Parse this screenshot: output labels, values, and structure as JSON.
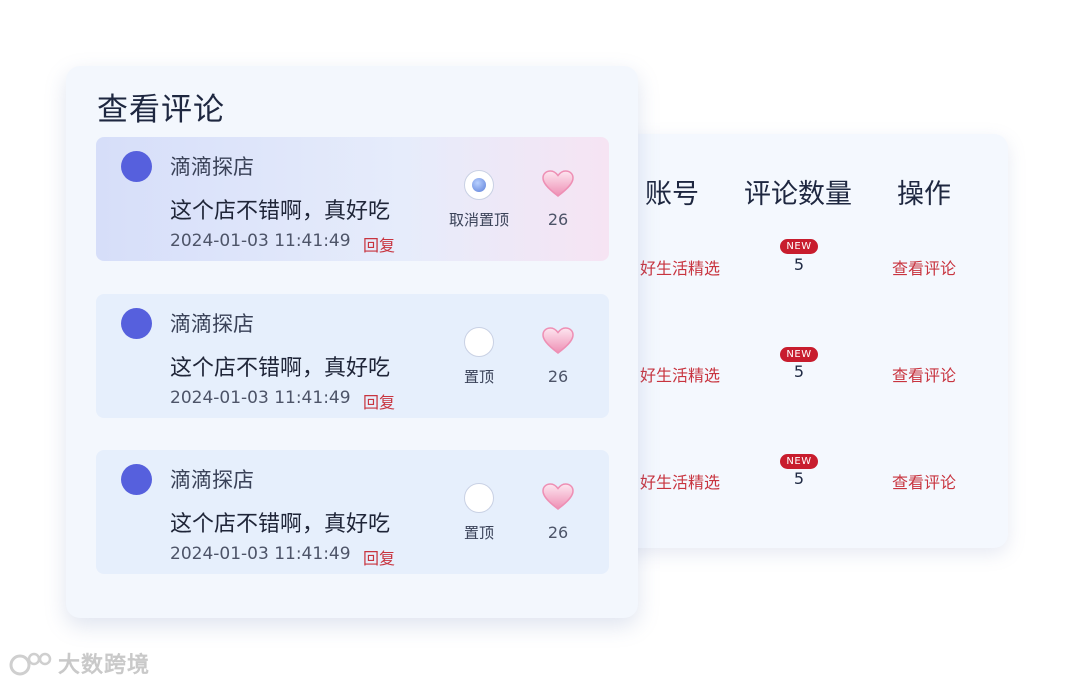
{
  "panel": {
    "title": "查看评论"
  },
  "comments": [
    {
      "username": "滴滴探店",
      "content": "这个店不错啊，真好吃",
      "timestamp": "2024-01-03 11:41:49",
      "reply": "回复",
      "pin_label": "取消置顶",
      "pinned": true,
      "likes": "26"
    },
    {
      "username": "滴滴探店",
      "content": "这个店不错啊，真好吃",
      "timestamp": "2024-01-03 11:41:49",
      "reply": "回复",
      "pin_label": "置顶",
      "pinned": false,
      "likes": "26"
    },
    {
      "username": "滴滴探店",
      "content": "这个店不错啊，真好吃",
      "timestamp": "2024-01-03 11:41:49",
      "reply": "回复",
      "pin_label": "置顶",
      "pinned": false,
      "likes": "26"
    }
  ],
  "table": {
    "headers": {
      "account": "账号",
      "count": "评论数量",
      "ops": "操作"
    },
    "rows": [
      {
        "account": "好生活精选",
        "badge": "NEW",
        "count": "5",
        "action": "查看评论"
      },
      {
        "account": "好生活精选",
        "badge": "NEW",
        "count": "5",
        "action": "查看评论"
      },
      {
        "account": "好生活精选",
        "badge": "NEW",
        "count": "5",
        "action": "查看评论"
      }
    ]
  },
  "watermark": {
    "text": "大数跨境"
  },
  "colors": {
    "accent_red": "#c8343f",
    "avatar_blue": "#5660dd",
    "badge_red": "#c81d2e",
    "heart_pink": "#ee8fb4"
  },
  "icons": {
    "avatar": "avatar-circle",
    "pin": "radio-icon",
    "like": "heart-icon"
  }
}
